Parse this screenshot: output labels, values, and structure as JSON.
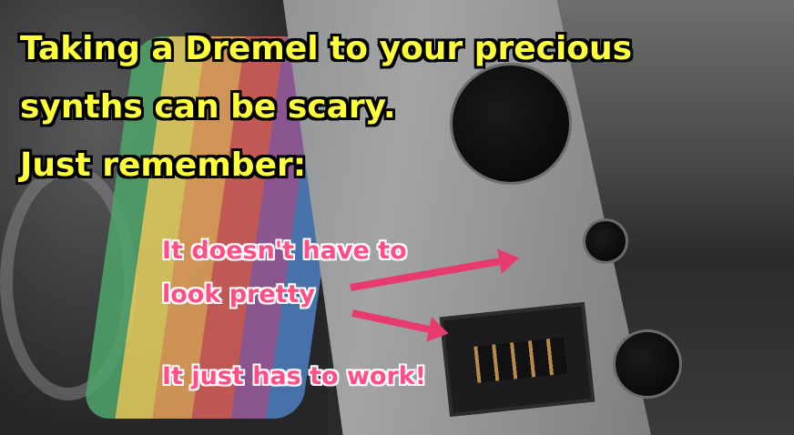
{
  "headline": {
    "line1": "Taking a Dremel to your precious",
    "line2": "synths can be scary.",
    "line3": "Just remember:"
  },
  "annotations": {
    "pretty_line1": "It doesn't have to",
    "pretty_line2": "look pretty",
    "work": "It just has to work!"
  },
  "colors": {
    "headline": "#ffff3a",
    "annotation": "#ff4f86",
    "arrow": "#e83b6d"
  }
}
